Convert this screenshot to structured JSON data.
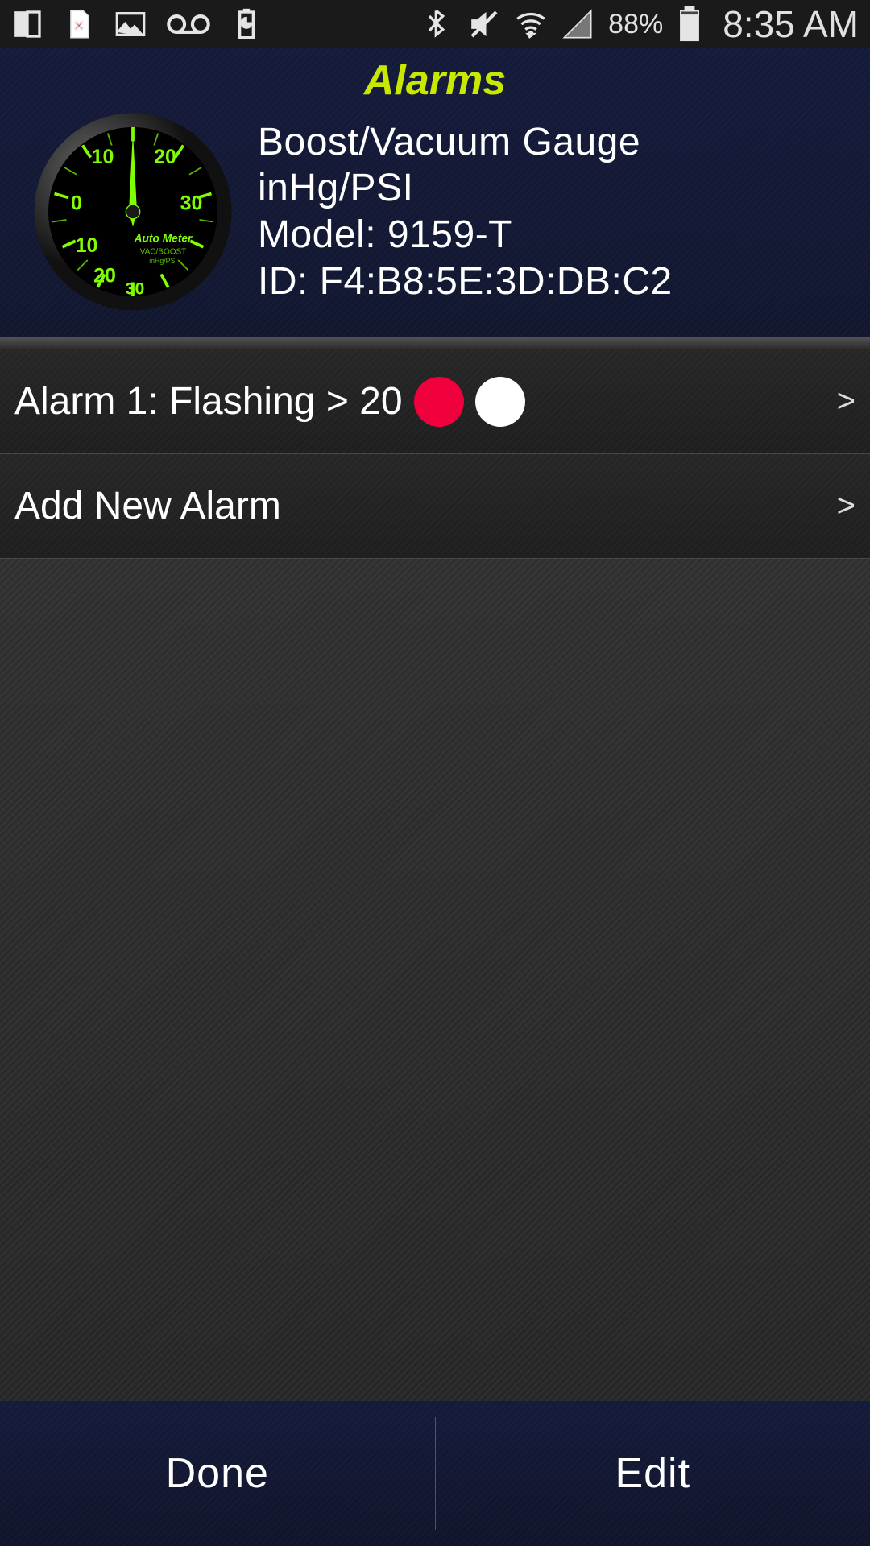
{
  "status": {
    "battery_percent": "88%",
    "time": "8:35 AM"
  },
  "header": {
    "title": "Alarms",
    "gauge_name": "Boost/Vacuum Gauge",
    "gauge_units": "inHg/PSI",
    "gauge_model": "Model: 9159-T",
    "gauge_id": "ID: F4:B8:5E:3D:DB:C2",
    "gauge_brand": "Auto Meter",
    "gauge_sub1": "VAC/BOOST",
    "gauge_sub2": "inHg/PSI",
    "dial_labels": {
      "tl": "10",
      "tr": "20",
      "ml": "0",
      "mr": "30",
      "bl1": "10",
      "bl2": "20",
      "bc": "30"
    }
  },
  "alarms": {
    "item1_label": "Alarm 1: Flashing > 20",
    "item1_color1": "#f0003c",
    "item1_color2": "#ffffff",
    "add_label": "Add New Alarm",
    "chevron": ">"
  },
  "bottom": {
    "done": "Done",
    "edit": "Edit"
  }
}
